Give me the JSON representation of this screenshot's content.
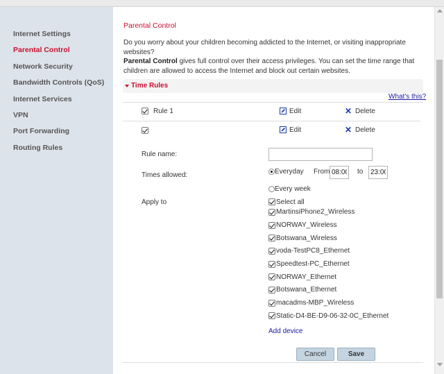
{
  "sidebar": {
    "items": [
      {
        "label": "Internet Settings",
        "active": false
      },
      {
        "label": "Parental Control",
        "active": true
      },
      {
        "label": "Network Security",
        "active": false
      },
      {
        "label": "Bandwidth Controls (QoS)",
        "active": false
      },
      {
        "label": "Internet Services",
        "active": false
      },
      {
        "label": "VPN",
        "active": false
      },
      {
        "label": "Port Forwarding",
        "active": false
      },
      {
        "label": "Routing Rules",
        "active": false
      }
    ]
  },
  "main": {
    "title": "Parental Control",
    "description_line1": "Do you worry about your children becoming addicted to the Internet, or visiting inappropriate websites?",
    "description_bold": "Parental Control",
    "description_rest": " gives full control over their access privileges. You can set the time range that children are allowed to access the Internet and block out certain websites.",
    "section_title": "Time Rules",
    "whats_this": "What's this?",
    "rules": [
      {
        "name": "Rule 1",
        "checked": true,
        "edit_label": "Edit",
        "delete_label": "Delete"
      },
      {
        "name": "",
        "checked": true,
        "edit_label": "Edit",
        "delete_label": "Delete"
      }
    ],
    "form": {
      "rule_name_label": "Rule name:",
      "rule_name_value": "",
      "times_allowed_label": "Times allowed:",
      "everyday_label": "Everyday",
      "every_week_label": "Every week",
      "schedule_selected": "Everyday",
      "from_label": "From",
      "from_value": "08:00",
      "to_label": "to",
      "to_value": "23:00",
      "apply_to_label": "Apply to",
      "select_all_label": "Select all",
      "devices": [
        "MartinsiPhone2_Wireless",
        "NORWAY_Wireless",
        "Botswana_Wireless",
        "voda-TestPC8_Ethernet",
        "Speedtest-PC_Ethernet",
        "NORWAY_Ethernet",
        "Botswana_Ethernet",
        "macadms-MBP_Wireless",
        "Static-D4-BE-D9-06-32-0C_Ethernet"
      ],
      "add_device_label": "Add device",
      "cancel_label": "Cancel",
      "save_label": "Save"
    }
  },
  "colors": {
    "accent_red": "#c8102e",
    "link_blue": "#1a1aa0",
    "sidebar_bg": "#dde3ea",
    "button_bg": "#c4d4e0"
  }
}
